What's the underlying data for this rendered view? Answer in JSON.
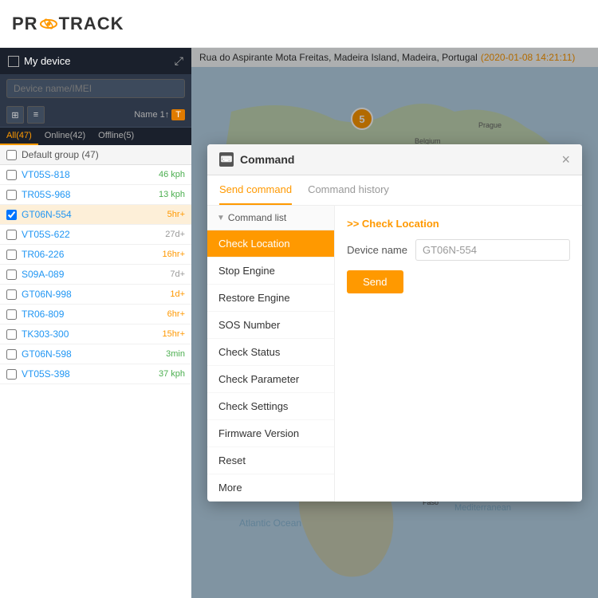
{
  "app": {
    "name": "PROTRACK"
  },
  "topbar": {
    "address": "Rua do Aspirante Mota Freitas, Madeira Island, Madeira, Portugal",
    "timestamp": "(2020-01-08 14:21:11)"
  },
  "sidebar": {
    "header": "My device",
    "search_placeholder": "Device name/IMEI",
    "toolbar": {
      "sort_label": "Name 1↑",
      "filter_label": "T"
    },
    "tabs": [
      {
        "label": "All(47)"
      },
      {
        "label": "Online(42)"
      },
      {
        "label": "Offline(5)"
      }
    ],
    "group": {
      "name": "Default group (47)"
    },
    "devices": [
      {
        "name": "VT05S-818",
        "status": "46 kph",
        "status_type": "green",
        "selected": false
      },
      {
        "name": "TR05S-968",
        "status": "13 kph",
        "status_type": "green",
        "selected": false
      },
      {
        "name": "GT06N-554",
        "status": "5hr+",
        "status_type": "orange",
        "selected": true
      },
      {
        "name": "VT05S-622",
        "status": "27d+",
        "status_type": "gray",
        "selected": false
      },
      {
        "name": "TR06-226",
        "status": "16hr+",
        "status_type": "orange",
        "selected": false
      },
      {
        "name": "S09A-089",
        "status": "7d+",
        "status_type": "gray",
        "selected": false
      },
      {
        "name": "GT06N-998",
        "status": "1d+",
        "status_type": "orange",
        "selected": false
      },
      {
        "name": "TR06-809",
        "status": "6hr+",
        "status_type": "orange",
        "selected": false
      },
      {
        "name": "TK303-300",
        "status": "15hr+",
        "status_type": "orange",
        "selected": false
      },
      {
        "name": "GT06N-598",
        "status": "3min",
        "status_type": "green",
        "selected": false
      },
      {
        "name": "VT05S-398",
        "status": "37 kph",
        "status_type": "green",
        "selected": false
      }
    ]
  },
  "map": {
    "cluster_count": "5"
  },
  "modal": {
    "title": "Command",
    "close_label": "×",
    "tabs": [
      {
        "label": "Send command",
        "active": true
      },
      {
        "label": "Command history",
        "active": false
      }
    ],
    "cmd_list_header": "Command list",
    "cmd_selected_label": ">> Check Location",
    "device_name_label": "Device name",
    "device_name_value": "GT06N-554",
    "send_button": "Send",
    "commands": [
      {
        "label": "Check Location",
        "selected": true
      },
      {
        "label": "Stop Engine",
        "selected": false
      },
      {
        "label": "Restore Engine",
        "selected": false
      },
      {
        "label": "SOS Number",
        "selected": false
      },
      {
        "label": "Check Status",
        "selected": false
      },
      {
        "label": "Check Parameter",
        "selected": false
      },
      {
        "label": "Check Settings",
        "selected": false
      },
      {
        "label": "Firmware Version",
        "selected": false
      },
      {
        "label": "Reset",
        "selected": false
      },
      {
        "label": "More",
        "selected": false
      }
    ]
  }
}
